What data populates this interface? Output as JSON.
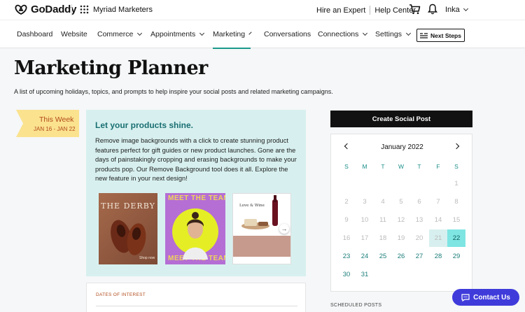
{
  "topbar": {
    "brand": "GoDaddy",
    "business": "Myriad Marketers",
    "hire": "Hire an Expert",
    "help": "Help Center",
    "user": "Inka"
  },
  "nav": {
    "items": [
      {
        "label": "Dashboard"
      },
      {
        "label": "Website"
      },
      {
        "label": "Commerce"
      },
      {
        "label": "Appointments"
      },
      {
        "label": "Marketing"
      },
      {
        "label": "Conversations"
      },
      {
        "label": "Connections"
      },
      {
        "label": "Settings"
      }
    ],
    "active": "Marketing",
    "next_steps": "Next Steps"
  },
  "page": {
    "title": "Marketing Planner",
    "subtitle": "A list of upcoming holidays, topics, and prompts to help inspire your social posts and related marketing campaigns."
  },
  "week": {
    "title": "This Week",
    "range": "JAN 16 - JAN 22"
  },
  "card": {
    "title": "Let your products shine.",
    "body": "Remove image backgrounds with a click to create stunning product features perfect for gift guides or new product launches. Gone are the days of painstakingly cropping and erasing backgrounds to make your products pop. Our Remove Background tool does it all. Explore the new feature in your next design!",
    "thumb1_text": "THE DERBY",
    "thumb1_small": "Shop now",
    "thumb2_text": "MEET THE TEAM",
    "thumb3_text": "Love & Wine"
  },
  "dates": {
    "label": "DATES OF INTEREST"
  },
  "create_post": "Create Social Post",
  "calendar": {
    "month": "January 2022",
    "weekdays": [
      "S",
      "M",
      "T",
      "W",
      "T",
      "F",
      "S"
    ],
    "week_days": [
      "21",
      "22"
    ],
    "today": "22",
    "rows": [
      [
        "",
        "",
        "",
        "",
        "",
        "",
        "1"
      ],
      [
        "2",
        "3",
        "4",
        "5",
        "6",
        "7",
        "8"
      ],
      [
        "9",
        "10",
        "11",
        "12",
        "13",
        "14",
        "15"
      ],
      [
        "16",
        "17",
        "18",
        "19",
        "20",
        "21",
        "22"
      ],
      [
        "23",
        "24",
        "25",
        "26",
        "27",
        "28",
        "29"
      ],
      [
        "30",
        "31",
        "",
        "",
        "",
        "",
        ""
      ]
    ]
  },
  "scheduled": "SCHEDULED POSTS",
  "contact": "Contact Us",
  "colors": {
    "accent": "#1b998b",
    "card_bg": "#d7f0ef",
    "week_tag": "#fbe28f",
    "today": "#7ee5e3",
    "contact": "#3f3bdb"
  }
}
